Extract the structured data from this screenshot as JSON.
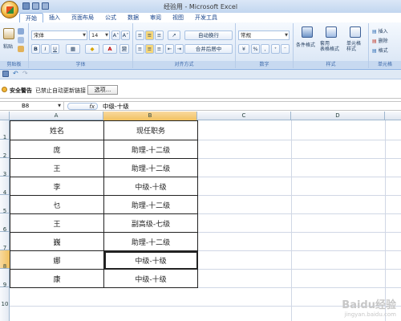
{
  "window": {
    "title": "经验用 - Microsoft Excel"
  },
  "tabs": [
    "开始",
    "插入",
    "页面布局",
    "公式",
    "数据",
    "审阅",
    "视图",
    "开发工具"
  ],
  "ribbon": {
    "clipboard": {
      "label": "剪贴板",
      "paste": "粘贴"
    },
    "font": {
      "label": "字体",
      "font_name": "宋体",
      "font_size": "14",
      "bold": "B",
      "italic": "I",
      "underline": "U",
      "font_color": "A",
      "grow": "A˄",
      "shrink": "A˅"
    },
    "alignment": {
      "label": "对齐方式",
      "wrap_text": "自动换行",
      "merge_center": "合并后居中"
    },
    "number": {
      "label": "数字",
      "format": "常规",
      "percent": "%",
      "comma": ",",
      "currency": "¥"
    },
    "styles": {
      "label": "样式",
      "conditional": "条件格式",
      "table_format": "套用\n表格格式",
      "cell_styles": "单元格\n样式"
    },
    "cells": {
      "label": "单元格",
      "insert": "插入",
      "delete": "删除",
      "format": "格式"
    }
  },
  "security_bar": {
    "title": "安全警告",
    "message": "已禁止自动更新链接",
    "options_button": "选项..."
  },
  "formula_bar": {
    "name_box": "B8",
    "fx": "fx",
    "content": "中级-十级"
  },
  "columns": [
    "A",
    "B",
    "C",
    "D"
  ],
  "rows": [
    "1",
    "2",
    "3",
    "4",
    "5",
    "6",
    "7",
    "8",
    "9",
    "10"
  ],
  "table": [
    [
      "姓名",
      "现任职务"
    ],
    [
      "庞",
      "助理-十二级"
    ],
    [
      "王",
      "助理-十二级"
    ],
    [
      "李",
      "中级-十级"
    ],
    [
      "乜",
      "助理-十二级"
    ],
    [
      "王",
      "副高级-七级"
    ],
    [
      "巍",
      "助理-十二级"
    ],
    [
      "娜",
      "中级-十级"
    ],
    [
      "康",
      "中级-十级"
    ]
  ],
  "active_cell": "B8",
  "watermark": {
    "main": "Baidu经验",
    "sub": "jingyan.baidu.com"
  }
}
